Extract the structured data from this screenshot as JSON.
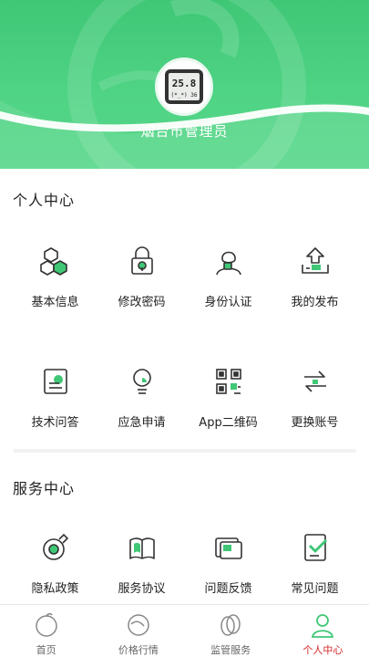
{
  "colors": {
    "brand": "#3fc776",
    "accent_icon": "#3fc776",
    "active_tab": "#d62424"
  },
  "profile": {
    "avatar_icon": "thermometer-hygrometer-image",
    "avatar_reading_main": "25.8",
    "avatar_reading_sub": "(*_*) 36",
    "username": "烟台市管理员"
  },
  "personal_center": {
    "title": "个人中心",
    "items": [
      {
        "label": "基本信息",
        "icon": "cubes-icon"
      },
      {
        "label": "修改密码",
        "icon": "lock-icon"
      },
      {
        "label": "身份认证",
        "icon": "person-id-icon"
      },
      {
        "label": "我的发布",
        "icon": "upload-icon"
      },
      {
        "label": "技术问答",
        "icon": "qa-doc-icon"
      },
      {
        "label": "应急申请",
        "icon": "bulb-icon"
      },
      {
        "label": "App二维码",
        "icon": "qr-code-icon"
      },
      {
        "label": "更换账号",
        "icon": "switch-icon"
      }
    ]
  },
  "service_center": {
    "title": "服务中心",
    "items": [
      {
        "label": "隐私政策",
        "icon": "privacy-icon"
      },
      {
        "label": "服务协议",
        "icon": "agreement-icon"
      },
      {
        "label": "问题反馈",
        "icon": "feedback-icon"
      },
      {
        "label": "常见问题",
        "icon": "faq-icon"
      }
    ]
  },
  "tabbar": {
    "tabs": [
      {
        "label": "首页",
        "icon": "home-icon",
        "active": false
      },
      {
        "label": "价格行情",
        "icon": "price-trend-icon",
        "active": false
      },
      {
        "label": "监管服务",
        "icon": "supervision-icon",
        "active": false
      },
      {
        "label": "个人中心",
        "icon": "profile-icon",
        "active": true
      }
    ]
  }
}
